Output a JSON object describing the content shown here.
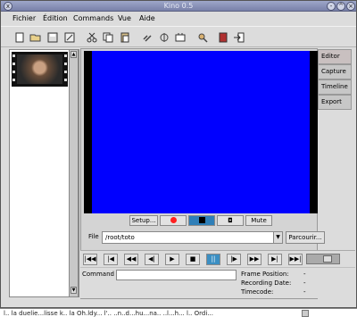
{
  "window": {
    "title": "Kino 0.5",
    "controls": [
      "minimize-icon",
      "maximize-icon",
      "close-icon"
    ]
  },
  "menu": {
    "items": [
      "Fichier",
      "Édition",
      "Commands",
      "Vue",
      "Aide"
    ]
  },
  "toolbar": {
    "icons": [
      "new-icon",
      "open-icon",
      "save-icon",
      "save-as-icon",
      "cut-icon",
      "copy-icon",
      "paste-icon",
      "link-icon",
      "split-icon",
      "trim-icon",
      "properties-icon",
      "book-icon",
      "exit-icon"
    ]
  },
  "side_tabs": [
    "Editor",
    "Capture",
    "Timeline",
    "Export"
  ],
  "capture_controls": {
    "setup_label": "Setup...",
    "mute_label": "Mute",
    "record_icon": "record-icon",
    "stop_icon": "stop-icon",
    "snapshot_icon": "camera-icon"
  },
  "file": {
    "label": "File",
    "value": "/root/toto",
    "browse_label": "Parcourir..."
  },
  "transport": {
    "buttons": [
      "⏮",
      "⏪",
      "◀◀",
      "◀|",
      "▶",
      "■",
      "||",
      "|▶",
      "▶▶",
      "▶|",
      "⏭"
    ]
  },
  "command": {
    "label": "Command",
    "value": ""
  },
  "info": {
    "frame_position_label": "Frame Position:",
    "frame_position_value": "-",
    "recording_date_label": "Recording Date:",
    "recording_date_value": "-",
    "timecode_label": "Timecode:",
    "timecode_value": "-"
  },
  "colors": {
    "video_background": "#0000ff",
    "record_red": "#ff2020",
    "active_blue": "#3b8fc3"
  },
  "bottom_strip": {
    "text": "l.. la duelie...lisse k.. la Oh.ldy... l'.. ..n..d...hu...na.. ..l...h... l.. Ordi..."
  }
}
